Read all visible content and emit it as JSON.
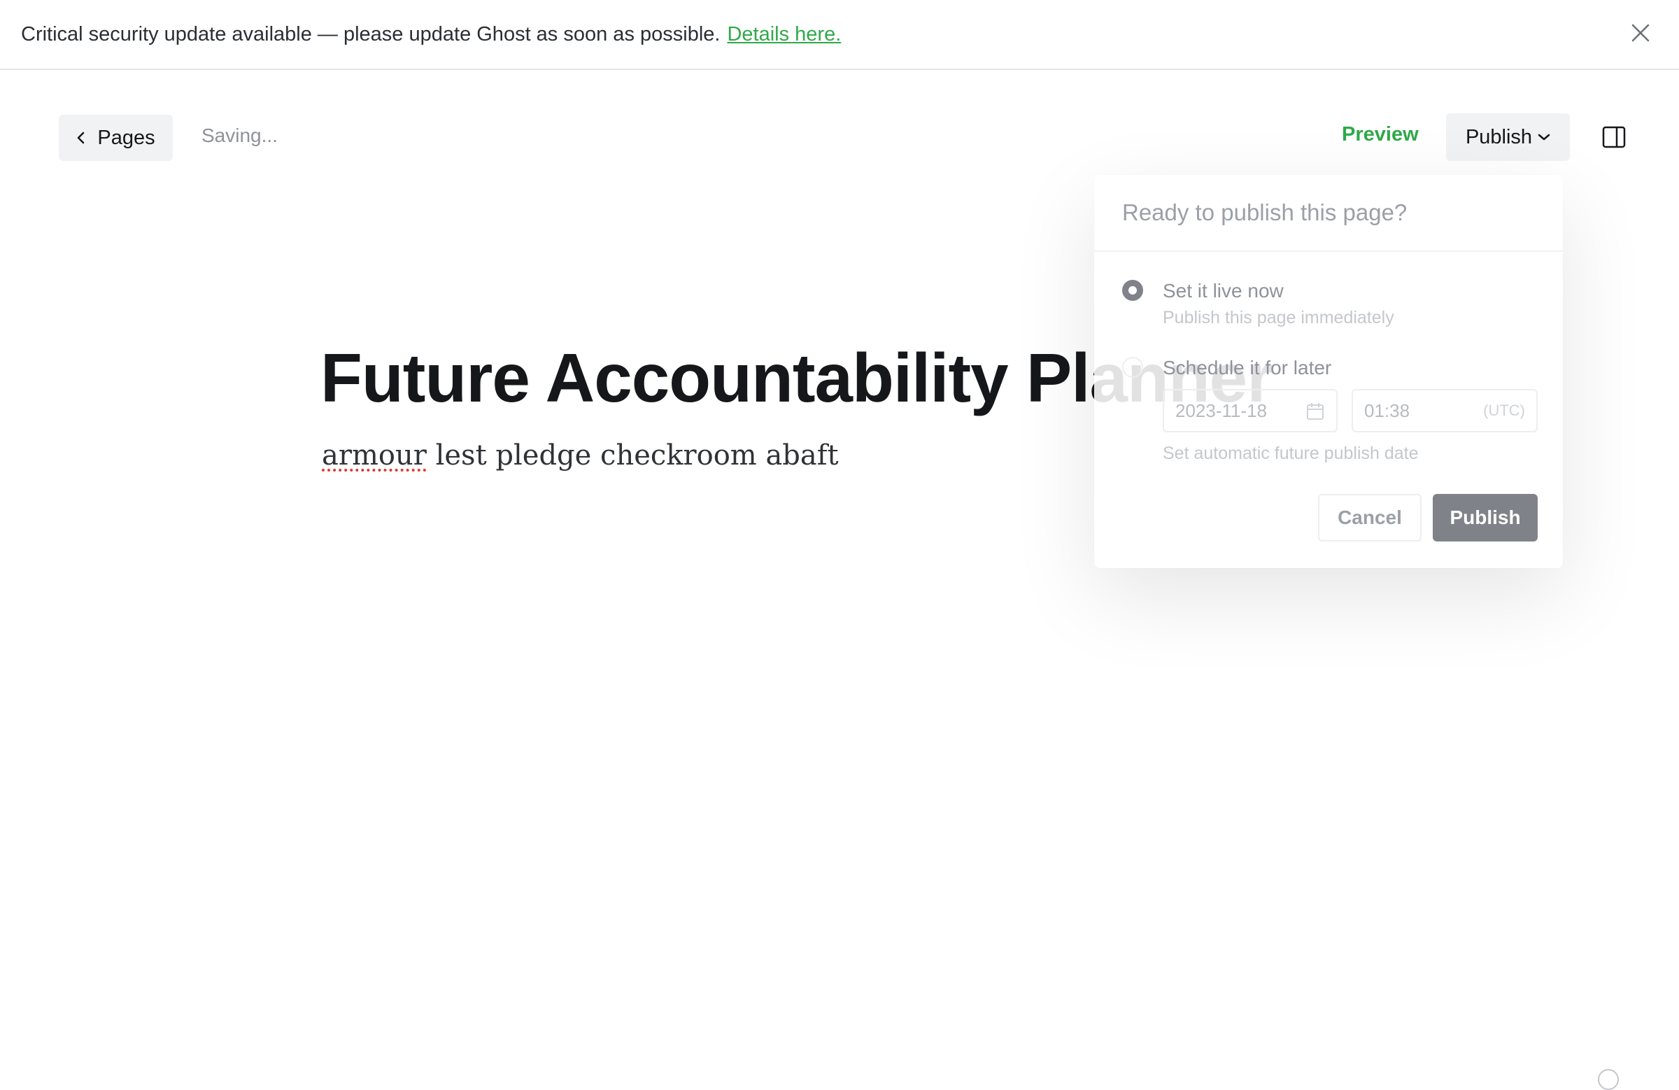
{
  "banner": {
    "message": "Critical security update available — please update Ghost as soon as possible.",
    "link_label": "Details here.",
    "close_icon": "close-icon"
  },
  "toolbar": {
    "back_label": "Pages",
    "back_icon": "chevron-left-icon",
    "status": "Saving...",
    "preview_label": "Preview",
    "publish_label": "Publish",
    "publish_icon": "chevron-down-icon",
    "sidebar_icon": "sidebar-toggle-icon"
  },
  "editor": {
    "title": "Future Accountability Planner",
    "body_misspelled_word": "armour",
    "body_rest": " lest pledge checkroom abaft"
  },
  "publish_menu": {
    "heading": "Ready to publish this page?",
    "option_now_label": "Set it live now",
    "option_now_sub": "Publish this page immediately",
    "option_later_label": "Schedule it for later",
    "date_value": "2023-11-18",
    "time_value": "01:38",
    "timezone": "(UTC)",
    "schedule_hint": "Set automatic future publish date",
    "cancel_label": "Cancel",
    "publish_label": "Publish",
    "selected_option": "now"
  },
  "colors": {
    "accent_green": "#30a94a",
    "button_grey": "#7f8389",
    "button_bg": "#f1f2f3"
  }
}
